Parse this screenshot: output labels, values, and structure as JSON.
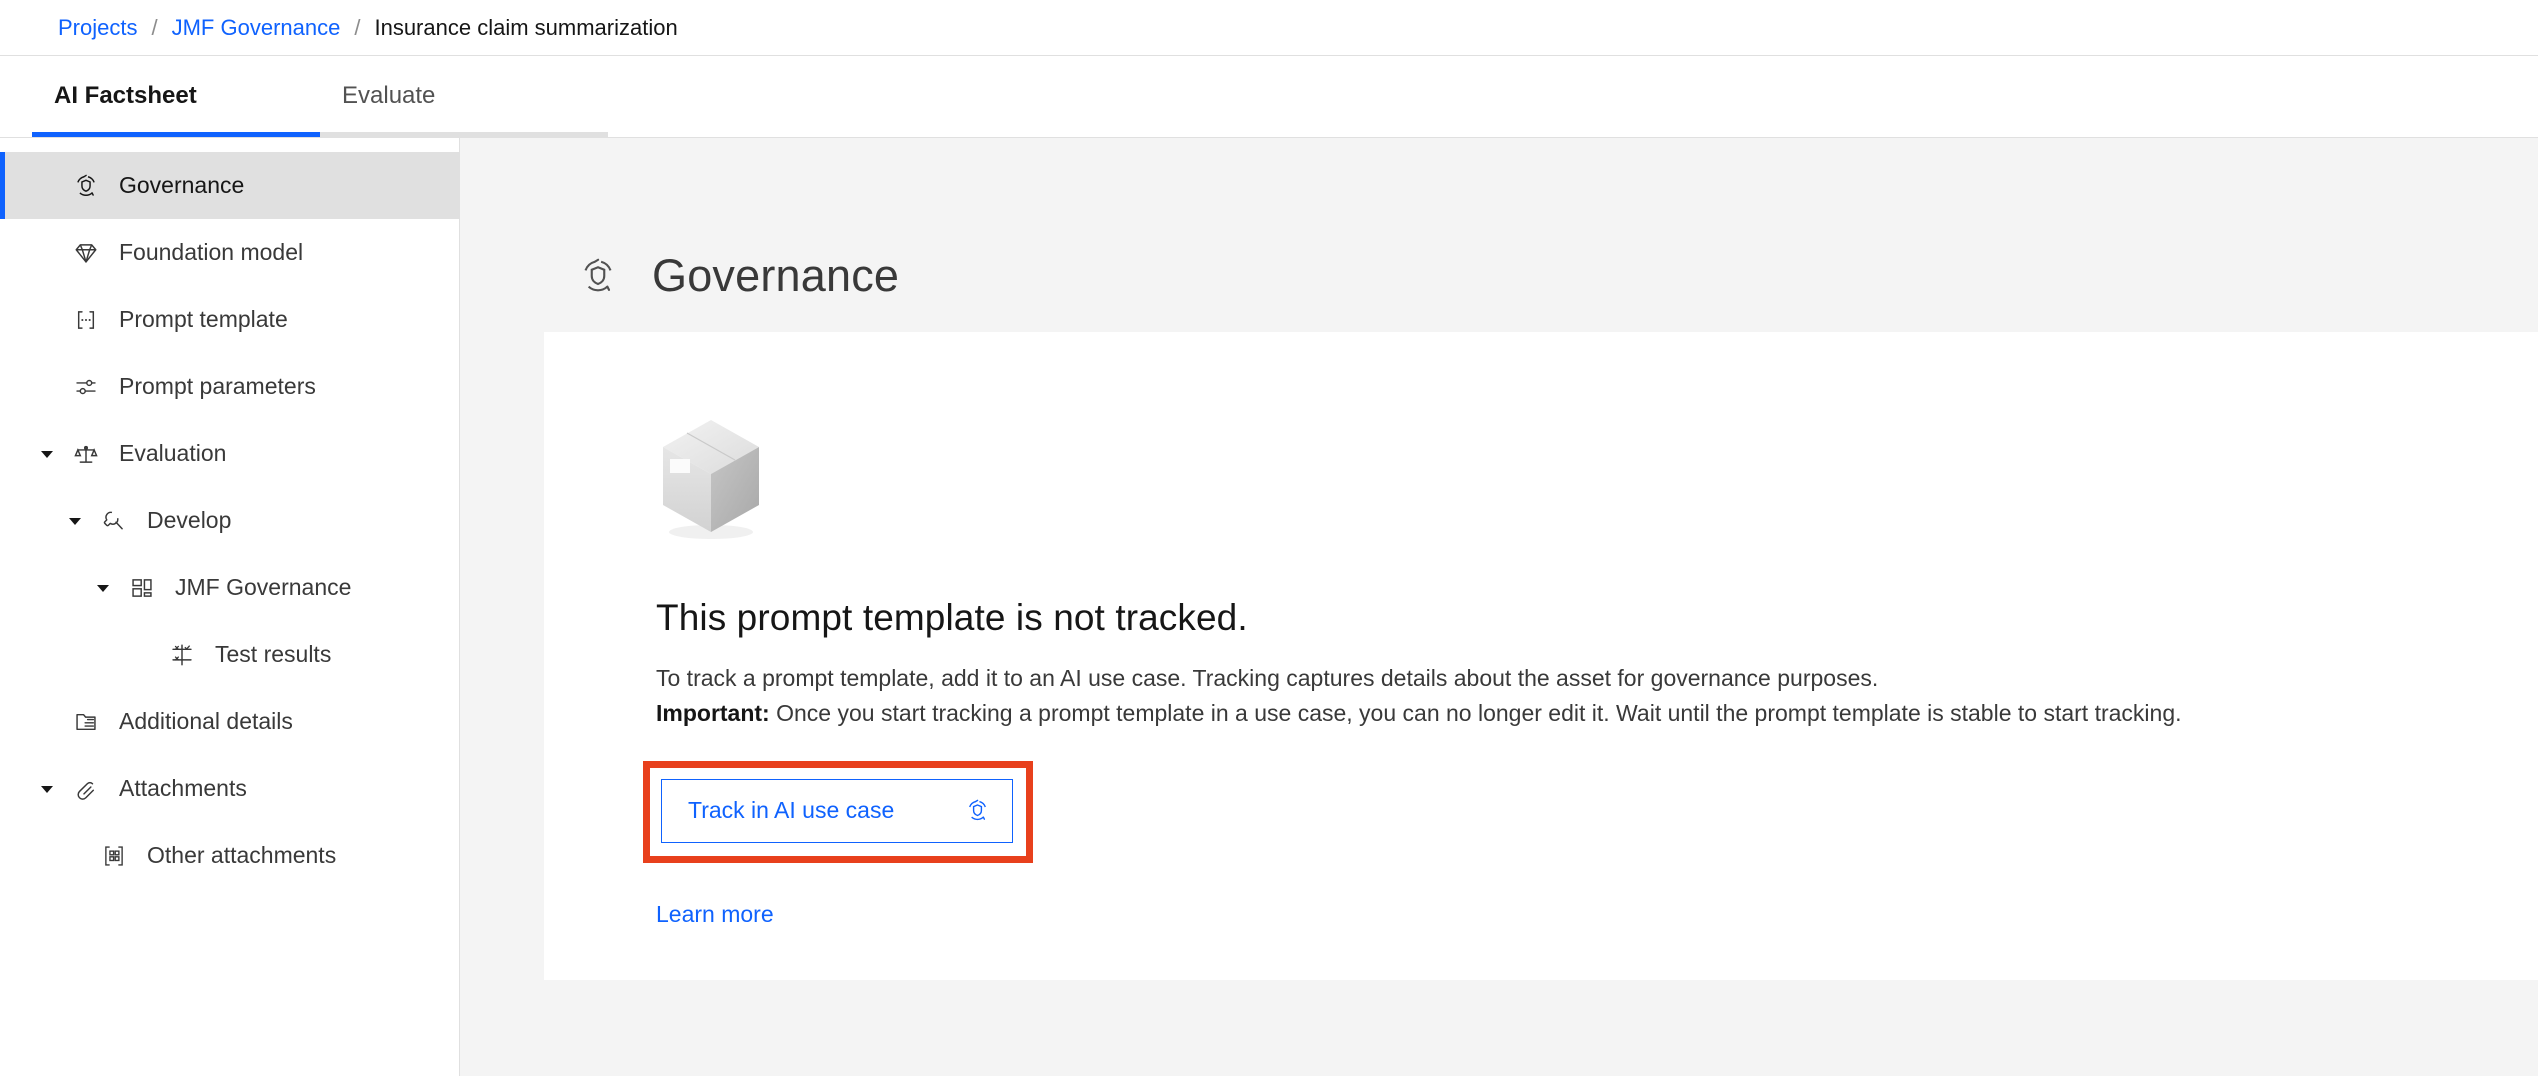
{
  "breadcrumb": {
    "items": [
      {
        "label": "Projects",
        "link": true
      },
      {
        "label": "JMF Governance",
        "link": true
      },
      {
        "label": "Insurance claim summarization",
        "link": false
      }
    ],
    "separator": "/"
  },
  "tabs": [
    {
      "label": "AI Factsheet",
      "active": true
    },
    {
      "label": "Evaluate",
      "active": false
    }
  ],
  "sidebar": {
    "items": [
      {
        "label": "Governance",
        "icon": "governance-icon",
        "level": 1,
        "selected": true,
        "caret": "none"
      },
      {
        "label": "Foundation model",
        "icon": "gem-icon",
        "level": 1,
        "selected": false,
        "caret": "none"
      },
      {
        "label": "Prompt template",
        "icon": "prompt-template-icon",
        "level": 1,
        "selected": false,
        "caret": "none"
      },
      {
        "label": "Prompt parameters",
        "icon": "sliders-icon",
        "level": 1,
        "selected": false,
        "caret": "none"
      },
      {
        "label": "Evaluation",
        "icon": "scales-icon",
        "level": 1,
        "selected": false,
        "caret": "expanded"
      },
      {
        "label": "Develop",
        "icon": "wrench-icon",
        "level": 2,
        "selected": false,
        "caret": "expanded"
      },
      {
        "label": "JMF Governance",
        "icon": "dashboard-icon",
        "level": 3,
        "selected": false,
        "caret": "expanded"
      },
      {
        "label": "Test results",
        "icon": "test-results-icon",
        "level": 4,
        "selected": false,
        "caret": "none"
      },
      {
        "label": "Additional details",
        "icon": "folder-details-icon",
        "level": 1,
        "selected": false,
        "caret": "none"
      },
      {
        "label": "Attachments",
        "icon": "paperclip-icon",
        "level": 1,
        "selected": false,
        "caret": "expanded"
      },
      {
        "label": "Other attachments",
        "icon": "grid-bracket-icon",
        "level": 2,
        "selected": false,
        "caret": "none"
      }
    ]
  },
  "main": {
    "page_title": "Governance",
    "page_icon": "governance-icon",
    "card": {
      "illustration": "empty-box-illustration",
      "title": "This prompt template is not tracked.",
      "paragraph_1": "To track a prompt template, add it to an AI use case. Tracking captures details about the asset for governance purposes.",
      "important_label": "Important:",
      "paragraph_2": " Once you start tracking a prompt template in a use case, you can no longer edit it. Wait until the prompt template is stable to start tracking.",
      "track_button_label": "Track in AI use case",
      "track_button_icon": "governance-icon",
      "learn_more_label": "Learn more"
    }
  },
  "colors": {
    "link": "#0f62fe",
    "accent_underline": "#0f62fe",
    "annotation_highlight": "#e8401c",
    "selected_bg": "#e0e0e0",
    "page_bg": "#f4f4f4"
  }
}
